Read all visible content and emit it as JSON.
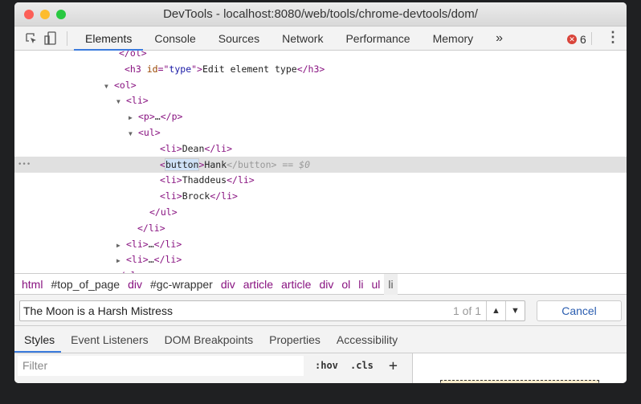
{
  "window": {
    "title": "DevTools - localhost:8080/web/tools/chrome-devtools/dom/"
  },
  "toolbar": {
    "tabs": [
      "Elements",
      "Console",
      "Sources",
      "Network",
      "Performance",
      "Memory"
    ],
    "more": "»",
    "error_count": "6",
    "icons": [
      "inspect-element-icon",
      "device-toolbar-icon",
      "error-icon",
      "more-menu-icon"
    ]
  },
  "dom": {
    "lines": [
      {
        "parts": [
          [
            "t",
            "</ol>"
          ]
        ]
      },
      {
        "parts": [
          [
            "t",
            "<h3 "
          ],
          [
            "a",
            "id"
          ],
          [
            "t",
            "=\""
          ],
          [
            "v",
            "type"
          ],
          [
            "t",
            "\">"
          ],
          [
            "x",
            "Edit element type"
          ],
          [
            "t",
            "</h3>"
          ]
        ]
      },
      {
        "tri": "▼",
        "parts": [
          [
            "t",
            "<ol>"
          ]
        ]
      },
      {
        "tri": "▼",
        "parts": [
          [
            "t",
            "<li>"
          ]
        ]
      },
      {
        "tri": "▶",
        "parts": [
          [
            "t",
            "<p>"
          ],
          [
            "x",
            "…"
          ],
          [
            "t",
            "</p>"
          ]
        ]
      },
      {
        "tri": "▼",
        "parts": [
          [
            "t",
            "<ul>"
          ]
        ]
      },
      {
        "parts": [
          [
            "t",
            "<li>"
          ],
          [
            "x",
            "Dean"
          ],
          [
            "t",
            "</li>"
          ]
        ]
      },
      {
        "selected": true,
        "parts": [
          [
            "t",
            "<"
          ],
          [
            "edit",
            "button"
          ],
          [
            "t",
            ">"
          ],
          [
            "x",
            "Hank"
          ],
          [
            "g",
            "</button> == "
          ],
          [
            "gi",
            "$0"
          ]
        ]
      },
      {
        "parts": [
          [
            "t",
            "<li>"
          ],
          [
            "x",
            "Thaddeus"
          ],
          [
            "t",
            "</li>"
          ]
        ]
      },
      {
        "parts": [
          [
            "t",
            "<li>"
          ],
          [
            "x",
            "Brock"
          ],
          [
            "t",
            "</li>"
          ]
        ]
      },
      {
        "parts": [
          [
            "t",
            "</ul>"
          ]
        ]
      },
      {
        "parts": [
          [
            "t",
            "</li>"
          ]
        ]
      },
      {
        "tri": "▶",
        "parts": [
          [
            "t",
            "<li>"
          ],
          [
            "x",
            "…"
          ],
          [
            "t",
            "</li>"
          ]
        ]
      },
      {
        "tri": "▶",
        "parts": [
          [
            "t",
            "<li>"
          ],
          [
            "x",
            "…"
          ],
          [
            "t",
            "</li>"
          ]
        ]
      },
      {
        "parts": [
          [
            "t",
            "</ol>"
          ]
        ]
      }
    ],
    "ellipsis": "•••"
  },
  "breadcrumb": [
    "html",
    "#top_of_page",
    "div",
    "#gc-wrapper",
    "div",
    "article",
    "article",
    "div",
    "ol",
    "li",
    "ul",
    "li"
  ],
  "search": {
    "value": "The Moon is a Harsh Mistress",
    "count": "1 of 1",
    "prev": "▲",
    "next": "▼",
    "cancel": "Cancel"
  },
  "subtabs": [
    "Styles",
    "Event Listeners",
    "DOM Breakpoints",
    "Properties",
    "Accessibility"
  ],
  "filter": {
    "placeholder": "Filter",
    "hov": ":hov",
    "cls": ".cls",
    "add": "+"
  }
}
